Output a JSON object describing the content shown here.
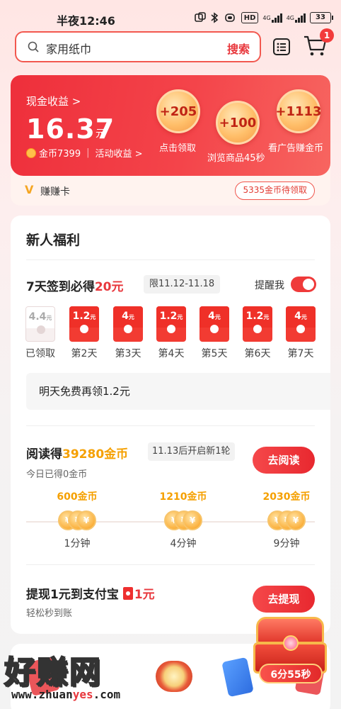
{
  "status_bar": {
    "time": "半夜12:46",
    "network_label": "HD",
    "signal_labels": [
      "4G",
      "4G"
    ],
    "battery": "33"
  },
  "search": {
    "placeholder": "家用纸巾",
    "button_label": "搜索"
  },
  "cart": {
    "badge_count": "1"
  },
  "cash_card": {
    "label": "现金收益 >",
    "amount": "16.37",
    "unit": "元",
    "coins_label": "金币7399",
    "activity_label": "活动收益 >",
    "bubbles": [
      {
        "value": "+205",
        "label": "点击领取"
      },
      {
        "value": "+100",
        "label": "浏览商品45秒"
      },
      {
        "value": "+1113",
        "label": "看广告赚金币"
      }
    ],
    "earn_card_label": "赚赚卡",
    "pending_coins_label": "5335金币待领取"
  },
  "newcomer": {
    "section_title": "新人福利",
    "signin": {
      "title_prefix": "7天签到必得",
      "title_highlight": "20元",
      "date_range": "限11.12-11.18",
      "remind_label": "提醒我",
      "remind_on": true,
      "days": [
        {
          "value": "4.4",
          "unit": "元",
          "label": "已领取",
          "claimed": true
        },
        {
          "value": "1.2",
          "unit": "元",
          "label": "第2天",
          "claimed": false
        },
        {
          "value": "4",
          "unit": "元",
          "label": "第3天",
          "claimed": false
        },
        {
          "value": "1.2",
          "unit": "元",
          "label": "第4天",
          "claimed": false
        },
        {
          "value": "4",
          "unit": "元",
          "label": "第5天",
          "claimed": false
        },
        {
          "value": "1.2",
          "unit": "元",
          "label": "第6天",
          "claimed": false
        },
        {
          "value": "4",
          "unit": "元",
          "label": "第7天",
          "claimed": false
        }
      ],
      "tomorrow_tip": "明天免费再领1.2元"
    },
    "reading": {
      "title_prefix": "阅读得",
      "title_highlight": "39280金币",
      "tag": "11.13后开启新1轮",
      "subtitle": "今日已得0金币",
      "button_label": "去阅读",
      "milestones": [
        {
          "coins": "600金币",
          "time": "1分钟"
        },
        {
          "coins": "1210金币",
          "time": "4分钟"
        },
        {
          "coins": "2030金币",
          "time": "9分钟"
        }
      ],
      "coin_symbol": "¥"
    },
    "withdraw": {
      "title_prefix": "提现1元到支付宝",
      "title_highlight": "1元",
      "subtitle": "轻松秒到账",
      "button_label": "去提现"
    }
  },
  "chest": {
    "timer": "6分55秒"
  },
  "watermark": {
    "text": "好赚网",
    "url_prefix": "www.zhuan",
    "url_highlight": "yes",
    "url_suffix": ".com"
  },
  "colors": {
    "brand_red": "#e8383d",
    "gold": "#f5a000"
  }
}
